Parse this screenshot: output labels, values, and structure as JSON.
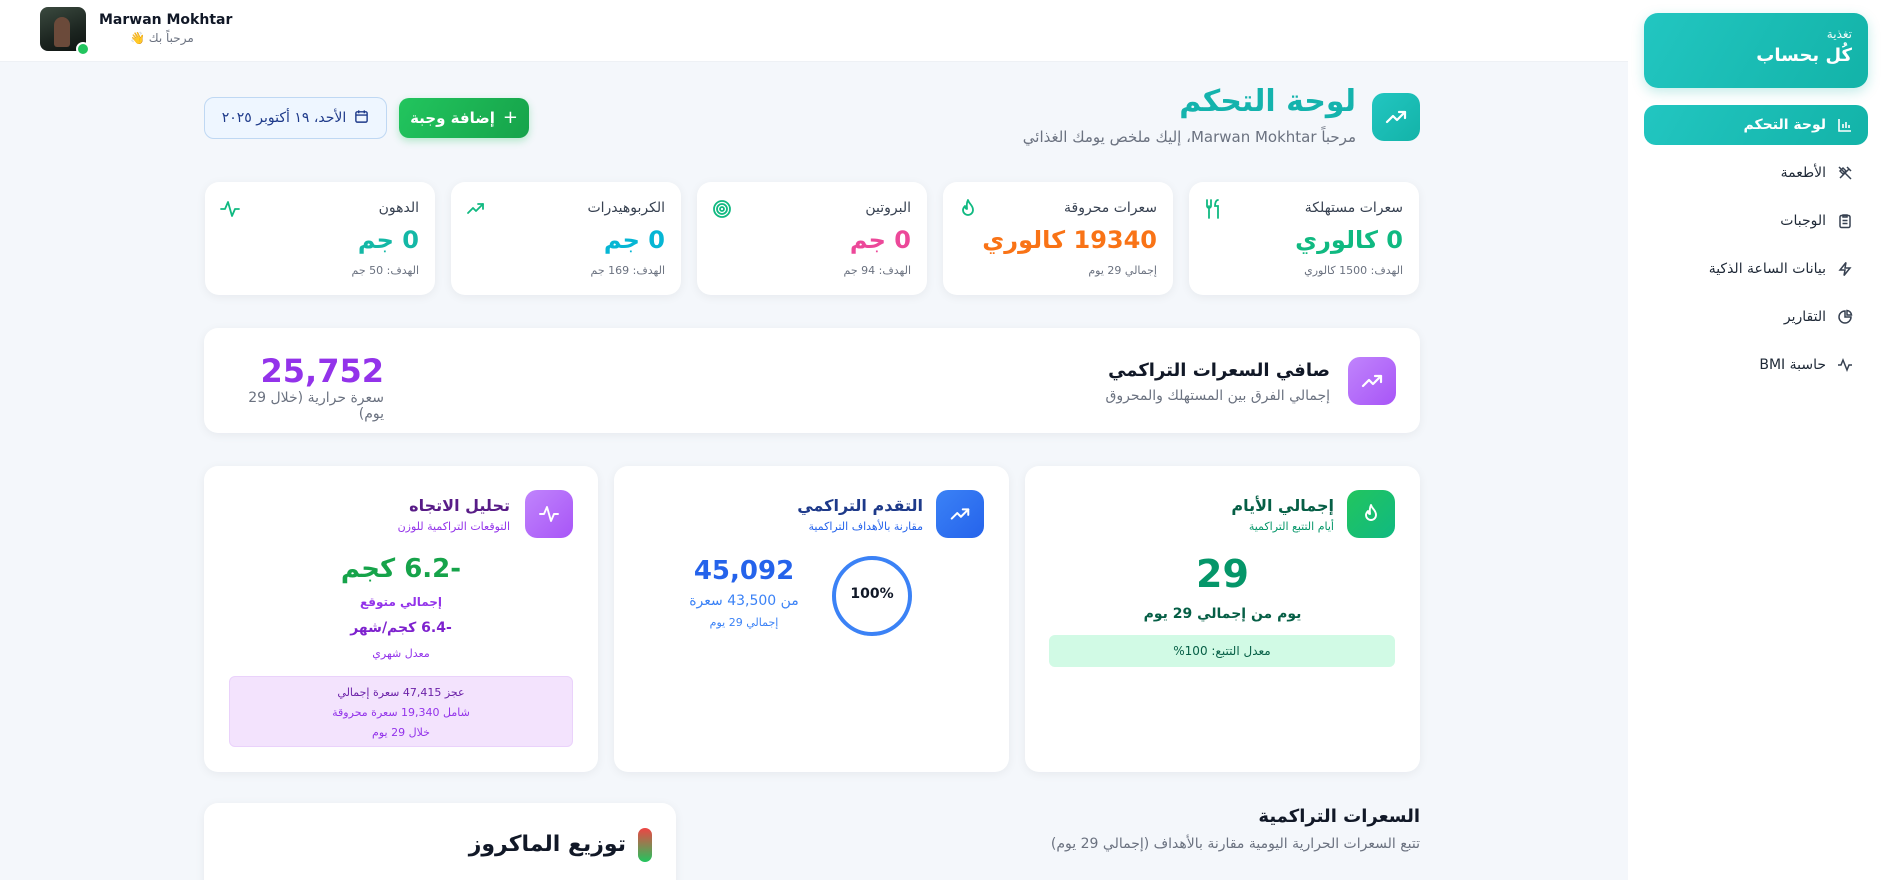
{
  "user": {
    "name": "Marwan Mokhtar",
    "greeting": "مرحباً بك 👋"
  },
  "brand": {
    "small": "تغذية",
    "big": "كُل بحساب"
  },
  "nav": [
    {
      "label": "لوحة التحكم",
      "icon": "bar-chart-icon",
      "active": true
    },
    {
      "label": "الأطعمة",
      "icon": "utensils-crossed-icon"
    },
    {
      "label": "الوجبات",
      "icon": "clipboard-icon"
    },
    {
      "label": "بيانات الساعة الذكية",
      "icon": "zap-icon"
    },
    {
      "label": "التقارير",
      "icon": "pie-chart-icon"
    },
    {
      "label": "حاسبة BMI",
      "icon": "activity-icon"
    }
  ],
  "header": {
    "title": "لوحة التحكم",
    "subtitle": "مرحباً Marwan Mokhtar، إليك ملخص يومك الغذائي",
    "date": "الأحد، ١٩ أكتوبر ٢٠٢٥",
    "add_meal": "إضافة وجبة"
  },
  "stats": [
    {
      "label": "سعرات مستهلكة",
      "value": "0 كالوري",
      "sub": "الهدف: 1500 كالوري",
      "color": "#10b981",
      "icon": "utensils-icon"
    },
    {
      "label": "سعرات محروقة",
      "value": "19340 كالوري",
      "sub": "إجمالي 29 يوم",
      "color": "#f97316",
      "icon": "flame-icon"
    },
    {
      "label": "البروتين",
      "value": "0 جم",
      "sub": "الهدف: 94 جم",
      "color": "#ec4899",
      "icon": "target-icon"
    },
    {
      "label": "الكربوهيدرات",
      "value": "0 جم",
      "sub": "الهدف: 169 جم",
      "color": "#06b6d4",
      "icon": "trending-up-icon"
    },
    {
      "label": "الدهون",
      "value": "0 جم",
      "sub": "الهدف: 50 جم",
      "color": "#14b8a6",
      "icon": "activity-icon"
    }
  ],
  "net": {
    "title": "صافي السعرات التراكمي",
    "subtitle": "إجمالي الفرق بين المستهلك والمحروق",
    "value": "25,752",
    "note": "سعرة حرارية (خلال 29 يوم)"
  },
  "days_card": {
    "title": "إجمالي الأيام",
    "subtitle": "أيام التتبع التراكمية",
    "value": "29",
    "line": "يوم من إجمالي 29 يوم",
    "rate": "معدل التتبع: 100%"
  },
  "progress_card": {
    "title": "التقدم التراكمي",
    "subtitle": "مقارنة بالأهداف التراكمية",
    "percent_label": "100%",
    "percent": 100,
    "value": "45,092",
    "of": "من 43,500 سعرة",
    "days": "إجمالي 29 يوم"
  },
  "trend_card": {
    "title": "تحليل الاتجاه",
    "subtitle": "التوقعات التراكمية للوزن",
    "value": "-6.2 كجم",
    "value_label": "إجمالي متوقع",
    "monthly": "-6.4 كجم/شهر",
    "monthly_label": "معدل شهري",
    "box": [
      "عجز 47,415 سعرة إجمالي",
      "شامل 19,340 سعرة محروقة",
      "خلال 29 يوم"
    ]
  },
  "bottom": {
    "macro_title": "توزيع الماكروز",
    "cum_title": "السعرات التراكمية",
    "cum_sub": "تتبع السعرات الحرارية اليومية مقارنة بالأهداف (إجمالي 29 يوم)"
  },
  "colors": {
    "accent": "#14b3ad",
    "purple": "#9333ea",
    "blue": "#2563eb",
    "green": "#059669"
  }
}
